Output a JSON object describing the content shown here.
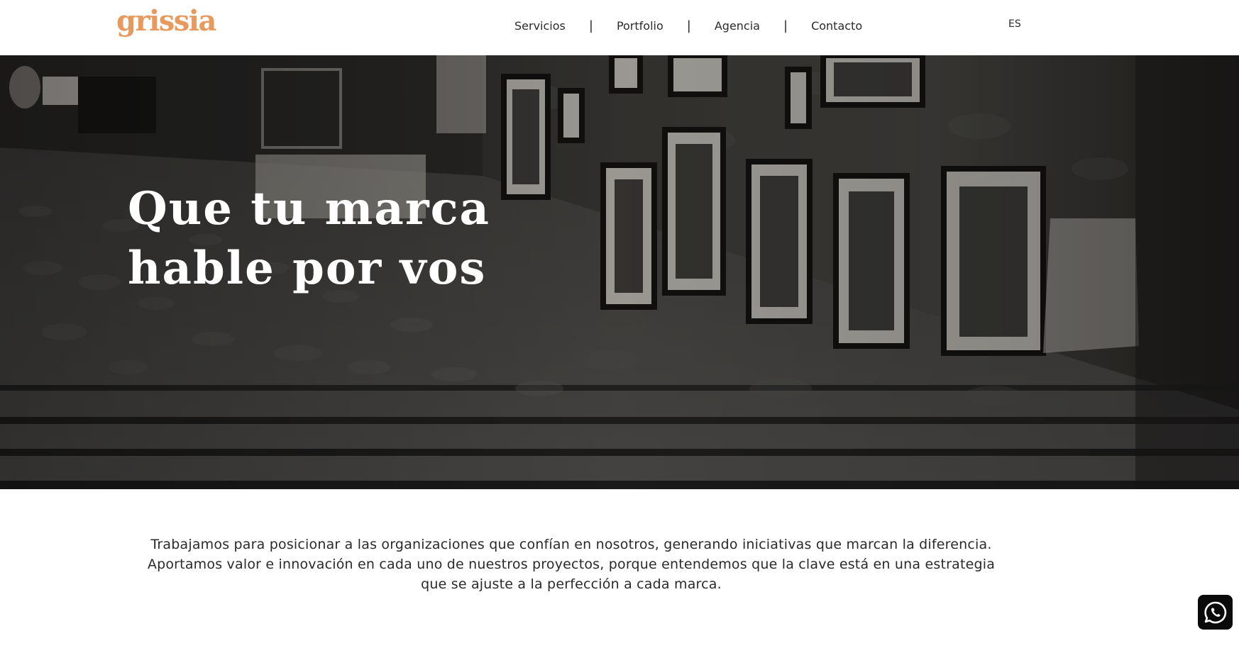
{
  "header": {
    "logo": "grissia",
    "nav": [
      "Servicios",
      "Portfolio",
      "Agencia",
      "Contacto"
    ],
    "separator": "|",
    "language": "ES"
  },
  "hero": {
    "title_line1": "Que tu marca",
    "title_line2": "hable por vos",
    "background": "black-and-white-street-gallery-photo"
  },
  "intro": {
    "line1": "Trabajamos para posicionar a las organizaciones que confían en nosotros, generando iniciativas que marcan la diferencia.",
    "line2": "Aportamos valor e innovación en cada uno de nuestros proyectos, porque entendemos que la clave está en una estrategia",
    "line3": "que se ajuste a la perfección a cada marca."
  },
  "whatsapp": {
    "icon": "whatsapp-icon"
  },
  "colors": {
    "brand": "#e89a5e",
    "text": "#2b2b2b",
    "hero_overlay": "#1f1e1d"
  }
}
